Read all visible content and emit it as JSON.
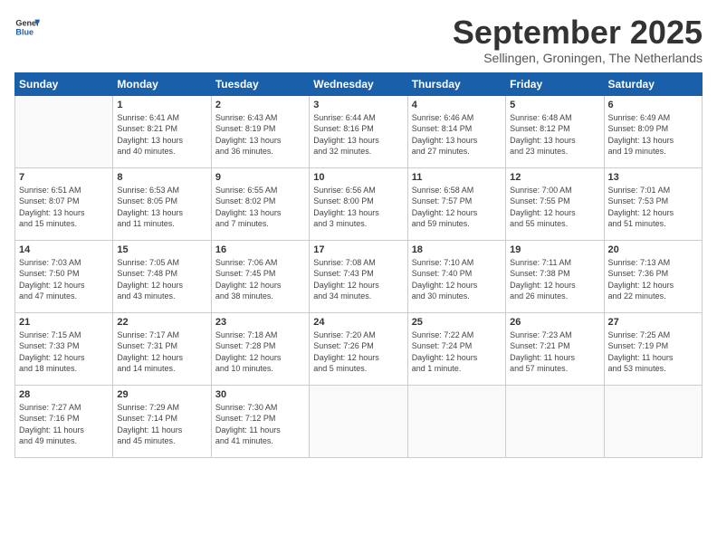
{
  "header": {
    "logo_general": "General",
    "logo_blue": "Blue",
    "month_title": "September 2025",
    "subtitle": "Sellingen, Groningen, The Netherlands"
  },
  "days_of_week": [
    "Sunday",
    "Monday",
    "Tuesday",
    "Wednesday",
    "Thursday",
    "Friday",
    "Saturday"
  ],
  "weeks": [
    [
      {
        "day": "",
        "info": ""
      },
      {
        "day": "1",
        "info": "Sunrise: 6:41 AM\nSunset: 8:21 PM\nDaylight: 13 hours\nand 40 minutes."
      },
      {
        "day": "2",
        "info": "Sunrise: 6:43 AM\nSunset: 8:19 PM\nDaylight: 13 hours\nand 36 minutes."
      },
      {
        "day": "3",
        "info": "Sunrise: 6:44 AM\nSunset: 8:16 PM\nDaylight: 13 hours\nand 32 minutes."
      },
      {
        "day": "4",
        "info": "Sunrise: 6:46 AM\nSunset: 8:14 PM\nDaylight: 13 hours\nand 27 minutes."
      },
      {
        "day": "5",
        "info": "Sunrise: 6:48 AM\nSunset: 8:12 PM\nDaylight: 13 hours\nand 23 minutes."
      },
      {
        "day": "6",
        "info": "Sunrise: 6:49 AM\nSunset: 8:09 PM\nDaylight: 13 hours\nand 19 minutes."
      }
    ],
    [
      {
        "day": "7",
        "info": "Sunrise: 6:51 AM\nSunset: 8:07 PM\nDaylight: 13 hours\nand 15 minutes."
      },
      {
        "day": "8",
        "info": "Sunrise: 6:53 AM\nSunset: 8:05 PM\nDaylight: 13 hours\nand 11 minutes."
      },
      {
        "day": "9",
        "info": "Sunrise: 6:55 AM\nSunset: 8:02 PM\nDaylight: 13 hours\nand 7 minutes."
      },
      {
        "day": "10",
        "info": "Sunrise: 6:56 AM\nSunset: 8:00 PM\nDaylight: 13 hours\nand 3 minutes."
      },
      {
        "day": "11",
        "info": "Sunrise: 6:58 AM\nSunset: 7:57 PM\nDaylight: 12 hours\nand 59 minutes."
      },
      {
        "day": "12",
        "info": "Sunrise: 7:00 AM\nSunset: 7:55 PM\nDaylight: 12 hours\nand 55 minutes."
      },
      {
        "day": "13",
        "info": "Sunrise: 7:01 AM\nSunset: 7:53 PM\nDaylight: 12 hours\nand 51 minutes."
      }
    ],
    [
      {
        "day": "14",
        "info": "Sunrise: 7:03 AM\nSunset: 7:50 PM\nDaylight: 12 hours\nand 47 minutes."
      },
      {
        "day": "15",
        "info": "Sunrise: 7:05 AM\nSunset: 7:48 PM\nDaylight: 12 hours\nand 43 minutes."
      },
      {
        "day": "16",
        "info": "Sunrise: 7:06 AM\nSunset: 7:45 PM\nDaylight: 12 hours\nand 38 minutes."
      },
      {
        "day": "17",
        "info": "Sunrise: 7:08 AM\nSunset: 7:43 PM\nDaylight: 12 hours\nand 34 minutes."
      },
      {
        "day": "18",
        "info": "Sunrise: 7:10 AM\nSunset: 7:40 PM\nDaylight: 12 hours\nand 30 minutes."
      },
      {
        "day": "19",
        "info": "Sunrise: 7:11 AM\nSunset: 7:38 PM\nDaylight: 12 hours\nand 26 minutes."
      },
      {
        "day": "20",
        "info": "Sunrise: 7:13 AM\nSunset: 7:36 PM\nDaylight: 12 hours\nand 22 minutes."
      }
    ],
    [
      {
        "day": "21",
        "info": "Sunrise: 7:15 AM\nSunset: 7:33 PM\nDaylight: 12 hours\nand 18 minutes."
      },
      {
        "day": "22",
        "info": "Sunrise: 7:17 AM\nSunset: 7:31 PM\nDaylight: 12 hours\nand 14 minutes."
      },
      {
        "day": "23",
        "info": "Sunrise: 7:18 AM\nSunset: 7:28 PM\nDaylight: 12 hours\nand 10 minutes."
      },
      {
        "day": "24",
        "info": "Sunrise: 7:20 AM\nSunset: 7:26 PM\nDaylight: 12 hours\nand 5 minutes."
      },
      {
        "day": "25",
        "info": "Sunrise: 7:22 AM\nSunset: 7:24 PM\nDaylight: 12 hours\nand 1 minute."
      },
      {
        "day": "26",
        "info": "Sunrise: 7:23 AM\nSunset: 7:21 PM\nDaylight: 11 hours\nand 57 minutes."
      },
      {
        "day": "27",
        "info": "Sunrise: 7:25 AM\nSunset: 7:19 PM\nDaylight: 11 hours\nand 53 minutes."
      }
    ],
    [
      {
        "day": "28",
        "info": "Sunrise: 7:27 AM\nSunset: 7:16 PM\nDaylight: 11 hours\nand 49 minutes."
      },
      {
        "day": "29",
        "info": "Sunrise: 7:29 AM\nSunset: 7:14 PM\nDaylight: 11 hours\nand 45 minutes."
      },
      {
        "day": "30",
        "info": "Sunrise: 7:30 AM\nSunset: 7:12 PM\nDaylight: 11 hours\nand 41 minutes."
      },
      {
        "day": "",
        "info": ""
      },
      {
        "day": "",
        "info": ""
      },
      {
        "day": "",
        "info": ""
      },
      {
        "day": "",
        "info": ""
      }
    ]
  ]
}
